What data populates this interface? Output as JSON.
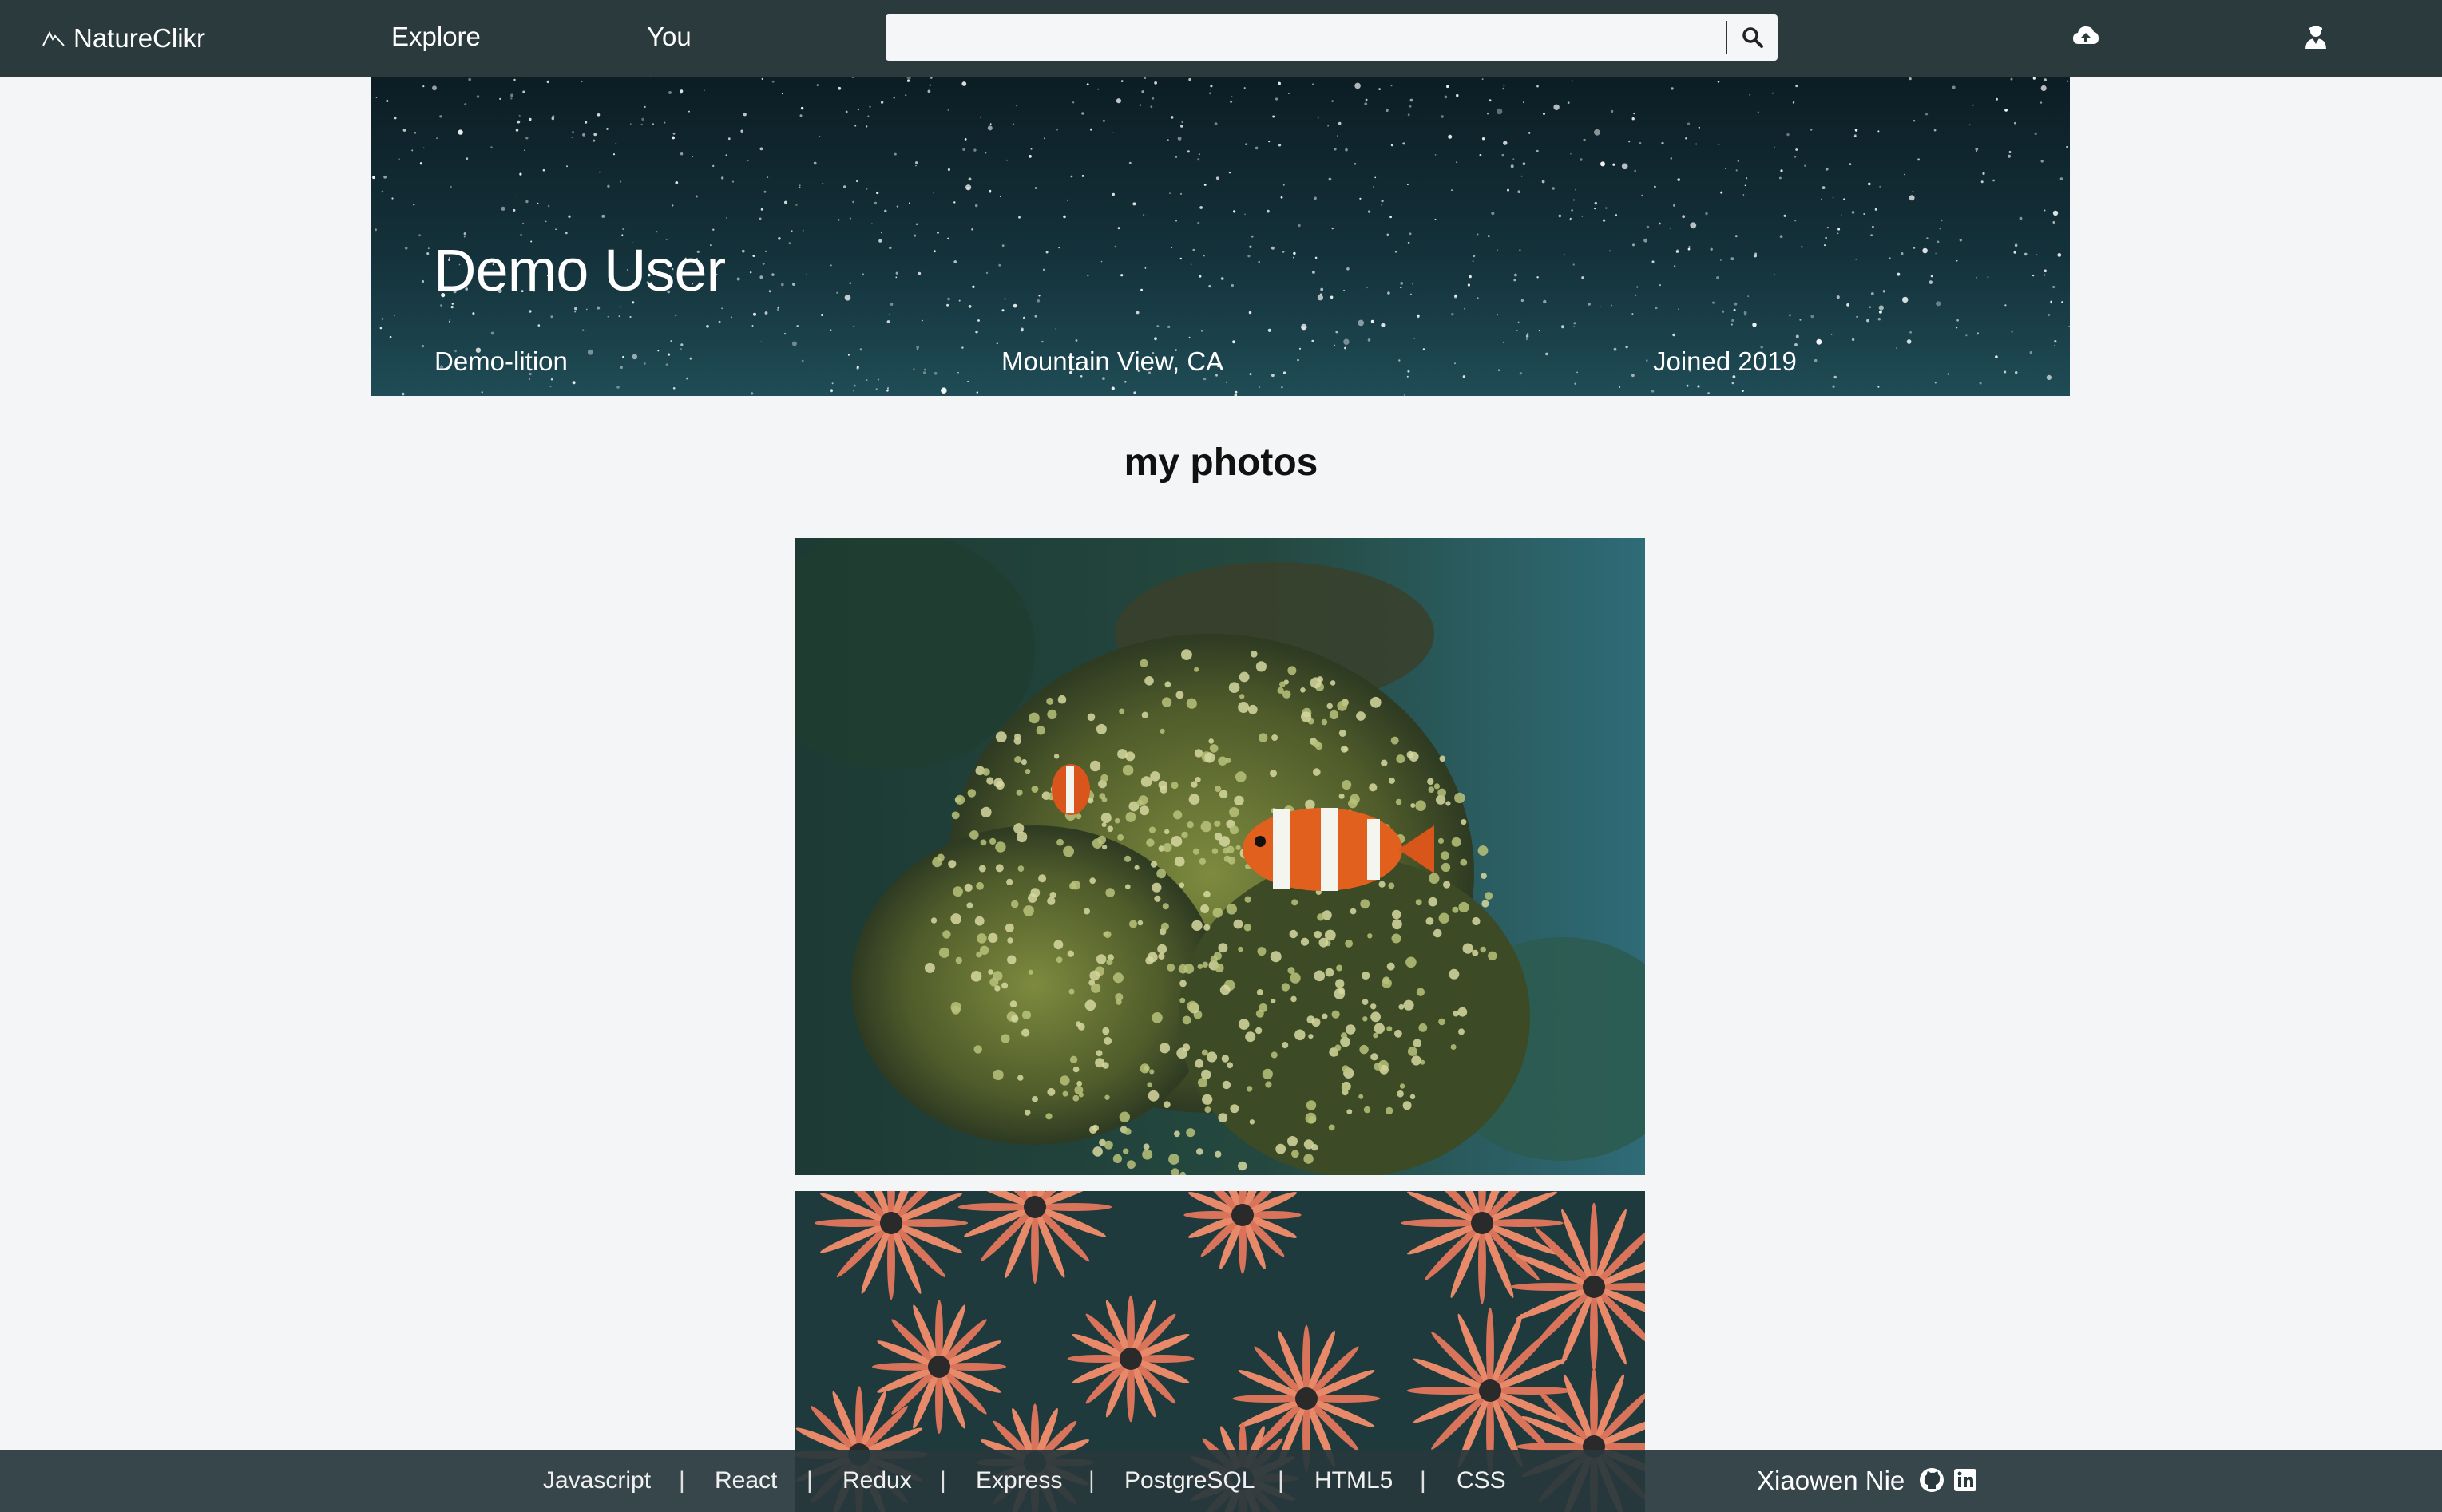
{
  "nav": {
    "brand": "NatureClikr",
    "explore": "Explore",
    "you": "You",
    "search_placeholder": "",
    "icons": [
      "mountain-logo-icon",
      "search-icon",
      "cloud-upload-icon",
      "user-profile-icon"
    ]
  },
  "profile": {
    "display_name": "Demo User",
    "username": "Demo-lition",
    "location": "Mountain View, CA",
    "joined": "Joined 2019"
  },
  "photos": {
    "title": "my photos",
    "items": [
      {
        "subject": "clownfish in sea anemone"
      },
      {
        "subject": "orange daisies"
      }
    ]
  },
  "footer": {
    "technologies": [
      "Javascript",
      "React",
      "Redux",
      "Express",
      "PostgreSQL",
      "HTML5",
      "CSS"
    ],
    "separator": "|",
    "author": "Xiaowen Nie",
    "icons": [
      "github-icon",
      "linkedin-icon"
    ]
  },
  "colors": {
    "nav_bg": "#2a3a3d",
    "page_bg": "#f3f5f7",
    "footer_bg": "#28383c",
    "text_light": "#ffffff"
  }
}
